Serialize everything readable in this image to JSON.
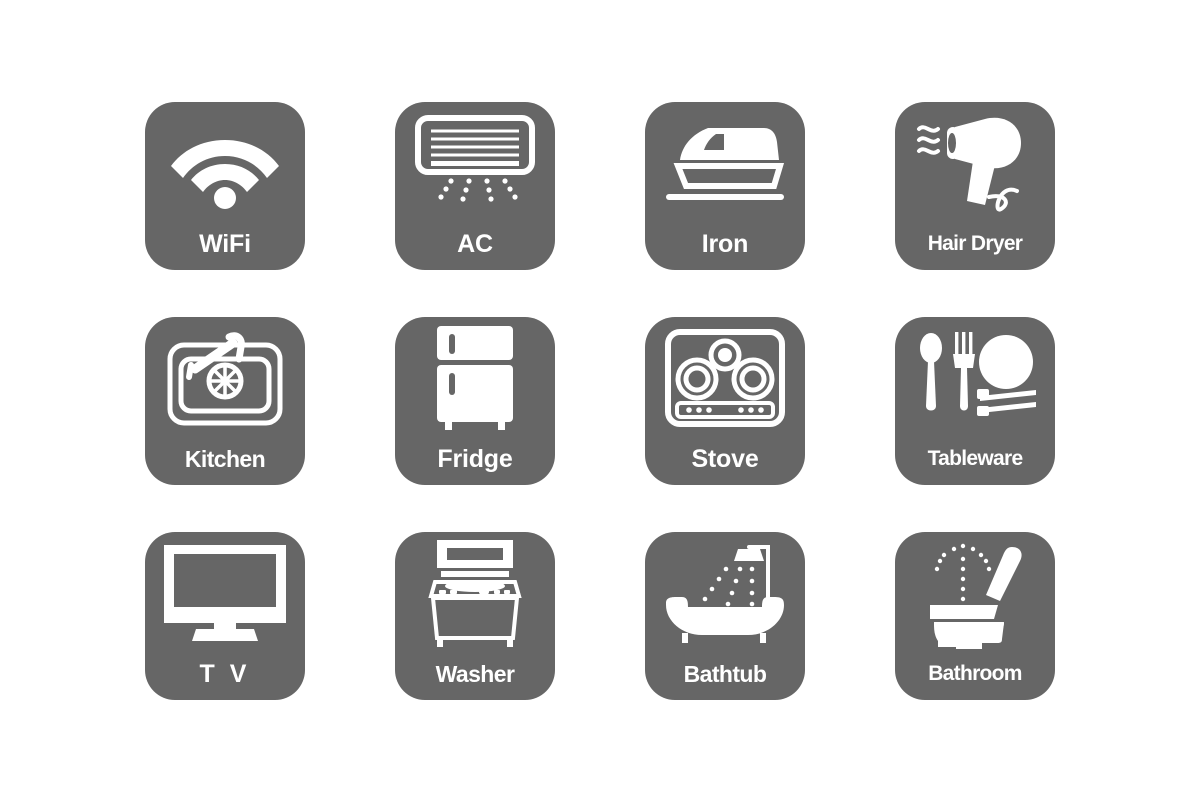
{
  "page": {
    "background_color": "#ffffff",
    "tile_color": "#666666",
    "icon_color": "#ffffff",
    "label_color": "#ffffff",
    "columns": 4,
    "rows": 3
  },
  "tiles": [
    {
      "id": "wifi",
      "label": "WiFi",
      "icon": "wifi-icon",
      "label_style": ""
    },
    {
      "id": "ac",
      "label": "AC",
      "icon": "ac-icon",
      "label_style": ""
    },
    {
      "id": "iron",
      "label": "Iron",
      "icon": "iron-icon",
      "label_style": ""
    },
    {
      "id": "hair-dryer",
      "label": "Hair Dryer",
      "icon": "hair-dryer-icon",
      "label_style": "shrink-2"
    },
    {
      "id": "kitchen",
      "label": "Kitchen",
      "icon": "kitchen-sink-icon",
      "label_style": "shrink-1"
    },
    {
      "id": "fridge",
      "label": "Fridge",
      "icon": "fridge-icon",
      "label_style": ""
    },
    {
      "id": "stove",
      "label": "Stove",
      "icon": "stove-icon",
      "label_style": ""
    },
    {
      "id": "tableware",
      "label": "Tableware",
      "icon": "tableware-icon",
      "label_style": "shrink-2"
    },
    {
      "id": "tv",
      "label": "T V",
      "icon": "tv-icon",
      "label_style": "wide"
    },
    {
      "id": "washer",
      "label": "Washer",
      "icon": "washer-icon",
      "label_style": "shrink-1"
    },
    {
      "id": "bathtub",
      "label": "Bathtub",
      "icon": "bathtub-icon",
      "label_style": "shrink-1"
    },
    {
      "id": "bathroom",
      "label": "Bathroom",
      "icon": "bathroom-toilet-icon",
      "label_style": "shrink-2"
    }
  ]
}
